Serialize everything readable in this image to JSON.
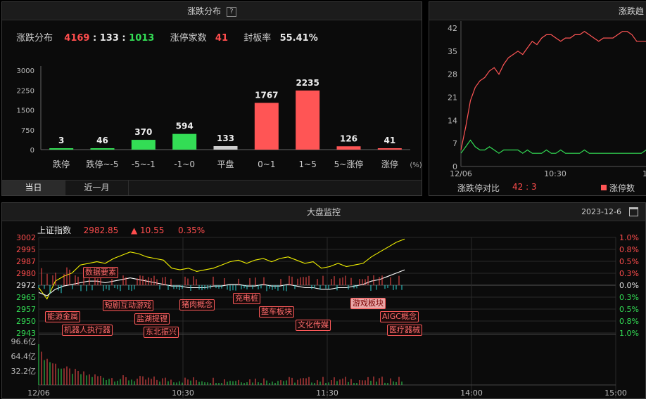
{
  "dist_panel": {
    "title": "涨跌分布",
    "help": "?",
    "summary_label": "涨跌分布",
    "up": "4169",
    "flat": "133",
    "down": "1013",
    "limit_label": "涨停家数",
    "limit_value": "41",
    "seal_label": "封板率",
    "seal_value": "55.41%",
    "tabs": [
      "当日",
      "近一月"
    ],
    "unit": "(%)",
    "chart_data": {
      "type": "bar",
      "categories": [
        "跌停",
        "跌停~-5",
        "-5~-1",
        "-1~0",
        "平盘",
        "0~1",
        "1~5",
        "5~涨停",
        "涨停"
      ],
      "values": [
        3,
        46,
        370,
        594,
        133,
        1767,
        2235,
        126,
        41
      ],
      "colors": [
        "#33dd55",
        "#33dd55",
        "#33dd55",
        "#33dd55",
        "#cccccc",
        "#ff5555",
        "#ff5555",
        "#ff5555",
        "#ff5555"
      ],
      "y_ticks": [
        "3000",
        "2250",
        "1500",
        "750",
        "0"
      ],
      "ylim": [
        0,
        3000
      ]
    }
  },
  "trend_panel": {
    "title": "涨跌趋",
    "ratio_label": "涨跌停对比",
    "ratio_value": "42 : 3",
    "legend_label": "涨停数",
    "legend_color": "#ff5555",
    "chart_data": {
      "type": "line",
      "y_ticks": [
        "42",
        "35",
        "28",
        "21",
        "14",
        "7",
        "0"
      ],
      "ylim": [
        0,
        42
      ],
      "x_ticks": [
        "12/06",
        "10:30",
        "11"
      ],
      "series": [
        {
          "color": "#ff5555",
          "values": [
            5,
            12,
            20,
            24,
            26,
            27,
            29,
            30,
            28,
            31,
            33,
            34,
            35,
            34,
            36,
            38,
            37,
            39,
            40,
            40,
            39,
            38,
            39,
            39,
            40,
            40,
            41,
            40,
            39,
            38,
            39,
            39,
            39,
            40,
            41,
            41,
            40,
            38,
            38,
            38,
            38
          ]
        },
        {
          "color": "#33dd55",
          "values": [
            4,
            6,
            8,
            6,
            5,
            5,
            6,
            5,
            4,
            5,
            5,
            5,
            5,
            4,
            5,
            4,
            4,
            4,
            5,
            4,
            4,
            5,
            4,
            4,
            4,
            4,
            5,
            4,
            4,
            4,
            4,
            4,
            4,
            4,
            4,
            4,
            4,
            4,
            4,
            5,
            4
          ]
        }
      ]
    }
  },
  "market_panel": {
    "title": "大盘监控",
    "date": "2023-12-6",
    "index_name": "上证指数",
    "index_value": "2982.85",
    "change": "10.55",
    "change_pct": "0.35%",
    "chart_data": {
      "type": "line",
      "y_left_ticks": [
        "3002",
        "2995",
        "2987",
        "2980",
        "2972",
        "2965",
        "2957",
        "2950",
        "2943"
      ],
      "y_left_colors": [
        "#ff4d4d",
        "#ff4d4d",
        "#ff4d4d",
        "#ff4d4d",
        "#e0e0e0",
        "#33dd55",
        "#33dd55",
        "#33dd55",
        "#33dd55"
      ],
      "y_right_ticks": [
        "1.0%",
        "0.8%",
        "0.5%",
        "0.3%",
        "0.0%",
        "0.3%",
        "0.5%",
        "0.8%",
        "1.0%"
      ],
      "ylim": [
        2943,
        3002
      ],
      "x_ticks": [
        "12/06",
        "10:30",
        "11:30",
        "14:00",
        "15:00"
      ],
      "vol_ticks": [
        "96.6亿",
        "64.4亿",
        "32.2亿"
      ],
      "series": [
        {
          "name": "price",
          "color": "#f0f000",
          "values": [
            2971,
            2964,
            2975,
            2978,
            2980,
            2985,
            2986,
            2987,
            2986,
            2989,
            2991,
            2993,
            2992,
            2990,
            2989,
            2988,
            2983,
            2982,
            2983,
            2981,
            2982,
            2983,
            2985,
            2987,
            2988,
            2986,
            2988,
            2989,
            2987,
            2989,
            2990,
            2988,
            2986,
            2987,
            2983,
            2984,
            2986,
            2984,
            2985,
            2986,
            2990,
            2993,
            2996,
            2999,
            3001
          ]
        },
        {
          "name": "avg",
          "color": "#ffffff",
          "values": [
            2968,
            2966,
            2970,
            2972,
            2973,
            2974,
            2975,
            2975,
            2974,
            2975,
            2976,
            2977,
            2976,
            2975,
            2974,
            2973,
            2972,
            2972,
            2971,
            2971,
            2971,
            2972,
            2972,
            2973,
            2973,
            2972,
            2972,
            2973,
            2972,
            2972,
            2973,
            2972,
            2971,
            2971,
            2970,
            2970,
            2971,
            2971,
            2972,
            2973,
            2975,
            2976,
            2978,
            2980,
            2982
          ]
        }
      ]
    },
    "events": [
      "数据要素",
      "能源金属",
      "机器人执行器",
      "短剧互动游戏",
      "盐湖提锂",
      "东北振兴",
      "猪肉概念",
      "充电桩",
      "整车板块",
      "文化传媒",
      "游戏板块",
      "AIGC概念",
      "医疗器械"
    ]
  }
}
